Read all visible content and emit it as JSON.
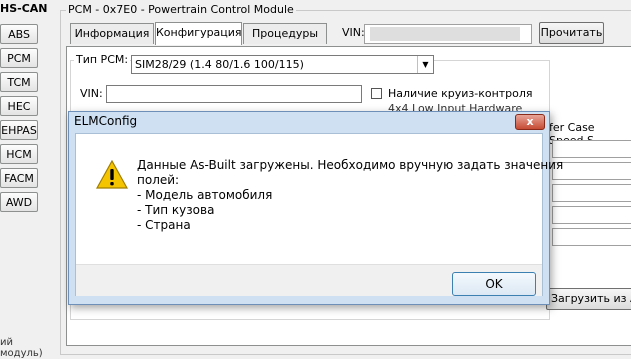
{
  "left_panel": {
    "bus_label": "HS-CAN",
    "modules": [
      "ABS",
      "PCM",
      "TCM",
      "HEC",
      "EHPAS",
      "HCM",
      "FACM",
      "AWD"
    ],
    "bottom_text": "ий модуль)"
  },
  "group": {
    "title": "PCM - 0x7E0 - Powertrain Control Module"
  },
  "tabs": [
    {
      "label": "Информация",
      "active": false
    },
    {
      "label": "Конфигурация",
      "active": true
    },
    {
      "label": "Процедуры",
      "active": false
    }
  ],
  "vin_top": {
    "label": "VIN:",
    "value": ""
  },
  "read_button": "Прочитать",
  "config": {
    "pcm_type_label": "Тип PCM:",
    "pcm_type_value": "SIM28/29 (1.4 80/1.6 100/115)",
    "vin_label": "VIN:",
    "vin_value": "",
    "cruise_label": "Наличие круиз-контроля",
    "hidden_check_label": "4x4 Low Input Hardware",
    "transfer_label": "fer Case Speed S",
    "load_button": "Загрузить из As-"
  },
  "dialog": {
    "title": "ELMConfig",
    "close_label": "x",
    "message_lines": [
      "Данные As-Built загружены. Необходимо вручную задать значения",
      "полей:",
      "- Модель автомобиля",
      "- Тип кузова",
      "- Страна"
    ],
    "ok_label": "OK"
  },
  "colors": {
    "dialog_frame": "#cfe0f3",
    "close_button": "#c64b33",
    "warning_icon": "#f5c400"
  },
  "icons": [
    "warning-icon",
    "dropdown-arrow-icon"
  ]
}
